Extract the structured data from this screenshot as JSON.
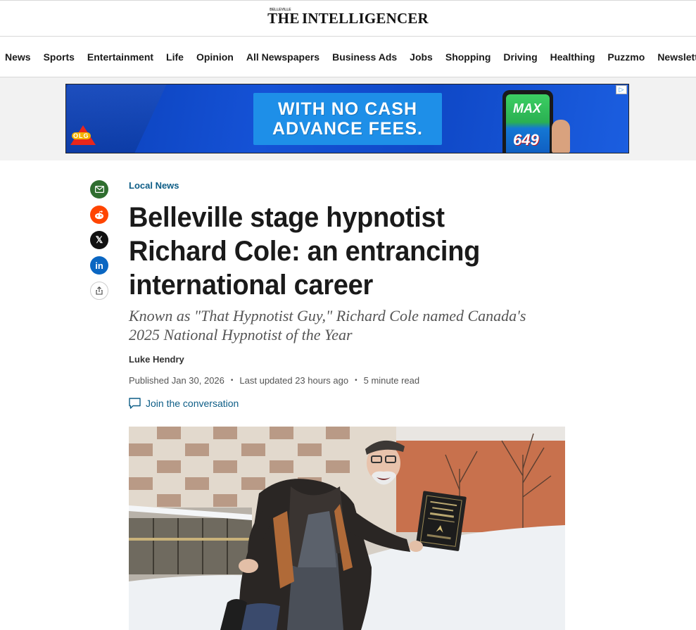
{
  "masthead": {
    "the": "THE",
    "tiny": "BELLEVILLE",
    "name": "INTELLIGENCER"
  },
  "nav": {
    "items": [
      "News",
      "Sports",
      "Entertainment",
      "Life",
      "Opinion",
      "All Newspapers",
      "Business Ads",
      "Jobs",
      "Shopping",
      "Driving",
      "Healthing",
      "Puzzmo",
      "Newsletters"
    ]
  },
  "ad": {
    "line1": "WITH NO CASH",
    "line2": "ADVANCE FEES.",
    "olg": "OLG",
    "max": "MAX",
    "lotto649": "649",
    "choice": "▷"
  },
  "share": {
    "email_icon": "email-icon",
    "reddit_icon": "reddit-icon",
    "x_icon": "x-icon",
    "linkedin_icon": "linkedin-icon",
    "share_icon": "share-icon",
    "linkedin_text": "in",
    "x_text": "𝕏"
  },
  "article": {
    "category": "Local News",
    "headline": "Belleville stage hypnotist Richard Cole: an entrancing international career",
    "dek": "Known as \"That Hypnotist Guy,\" Richard Cole named Canada's 2025 National Hypnotist of the Year",
    "author": "Luke Hendry",
    "published": "Published Jan 30, 2026",
    "updated": "Last updated 23 hours ago",
    "read_time": "5 minute read",
    "conversation": "Join the conversation"
  },
  "colors": {
    "link": "#0d5d86",
    "email": "#2f6e2f",
    "reddit": "#ff4500",
    "linkedin": "#0a66c2"
  }
}
